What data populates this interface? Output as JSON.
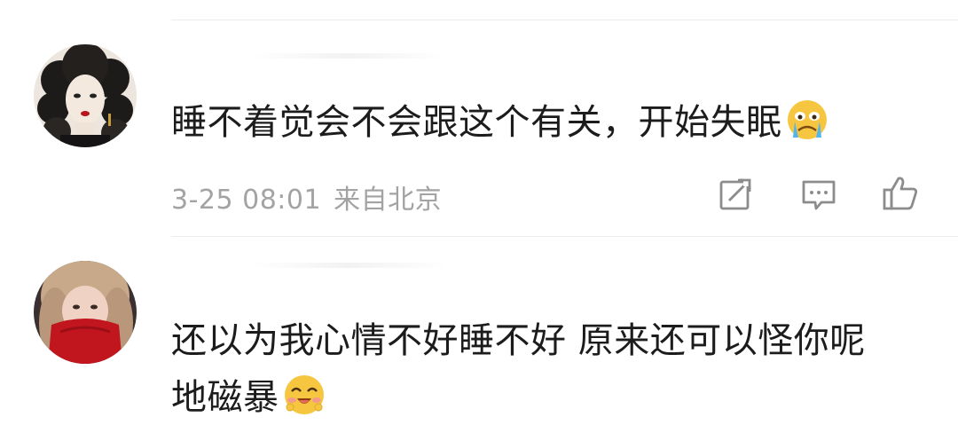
{
  "comments": [
    {
      "text": "睡不着觉会不会跟这个有关，开始失眠",
      "emoji": "crying-face-emoji",
      "date": "3-25 08:01",
      "location": "来自北京",
      "actions": [
        "share-icon",
        "comment-icon",
        "like-icon"
      ]
    },
    {
      "text_line1": "还以为我心情不好睡不好 原来还可以怪你呢",
      "text_line2": "地磁暴",
      "emoji": "blushing-smile-emoji"
    }
  ],
  "colors": {
    "text": "#1c1c1c",
    "meta": "#a3a3a3",
    "icon": "#8c8c8c",
    "divider": "#ececec",
    "emoji_yellow": "#f7c640"
  }
}
